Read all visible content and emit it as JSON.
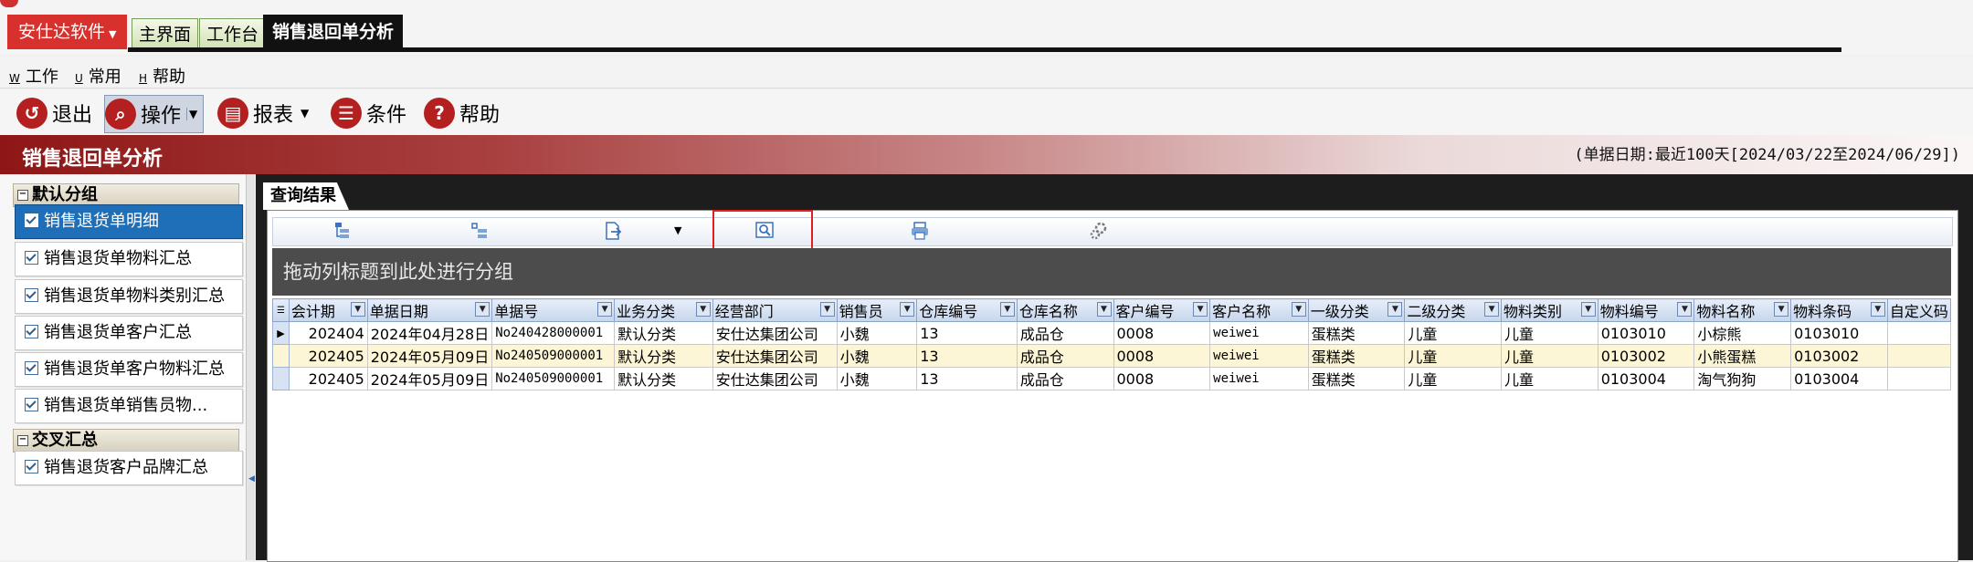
{
  "top_tabs": {
    "app_menu": "安仕达软件",
    "home": "主界面",
    "desk": "工作台",
    "active": "销售退回单分析"
  },
  "menu": [
    {
      "key": "W",
      "label": "工作"
    },
    {
      "key": "U",
      "label": "常用"
    },
    {
      "key": "H",
      "label": "帮助"
    }
  ],
  "toolbar": {
    "exit": "退出",
    "operate": "操作",
    "report": "报表",
    "condition": "条件",
    "help": "帮助"
  },
  "page": {
    "title": "销售退回单分析",
    "date_range": "(单据日期:最近100天[2024/03/22至2024/06/29])"
  },
  "sidebar": {
    "group1": "默认分组",
    "group1_items": [
      "销售退货单明细",
      "销售退货单物料汇总",
      "销售退货单物料类别汇总",
      "销售退货单客户汇总",
      "销售退货单客户物料汇总",
      "销售退货单销售员物..."
    ],
    "group2": "交叉汇总",
    "group2_items": [
      "销售退货客户品牌汇总"
    ]
  },
  "results": {
    "tab": "查询结果",
    "group_hint": "拖动列标题到此处进行分组"
  },
  "grid": {
    "columns": [
      "会计期",
      "单据日期",
      "单据号",
      "业务分类",
      "经营部门",
      "销售员",
      "仓库编号",
      "仓库名称",
      "客户编号",
      "客户名称",
      "一级分类",
      "二级分类",
      "物料类别",
      "物料编号",
      "物料名称",
      "物料条码",
      "自定义码"
    ],
    "rows": [
      [
        "202404",
        "2024年04月28日",
        "No240428000001",
        "默认分类",
        "安仕达集团公司",
        "小魏",
        "13",
        "成品仓",
        "0008",
        "weiwei",
        "蛋糕类",
        "儿童",
        "儿童",
        "0103010",
        "小棕熊",
        "0103010",
        ""
      ],
      [
        "202405",
        "2024年05月09日",
        "No240509000001",
        "默认分类",
        "安仕达集团公司",
        "小魏",
        "13",
        "成品仓",
        "0008",
        "weiwei",
        "蛋糕类",
        "儿童",
        "儿童",
        "0103002",
        "小熊蛋糕",
        "0103002",
        ""
      ],
      [
        "202405",
        "2024年05月09日",
        "No240509000001",
        "默认分类",
        "安仕达集团公司",
        "小魏",
        "13",
        "成品仓",
        "0008",
        "weiwei",
        "蛋糕类",
        "儿童",
        "儿童",
        "0103004",
        "淘气狗狗",
        "0103004",
        ""
      ]
    ]
  },
  "colors": {
    "accent_red": "#b42020",
    "selected_blue": "#1e6fb8",
    "highlight_box": "#e02020"
  }
}
